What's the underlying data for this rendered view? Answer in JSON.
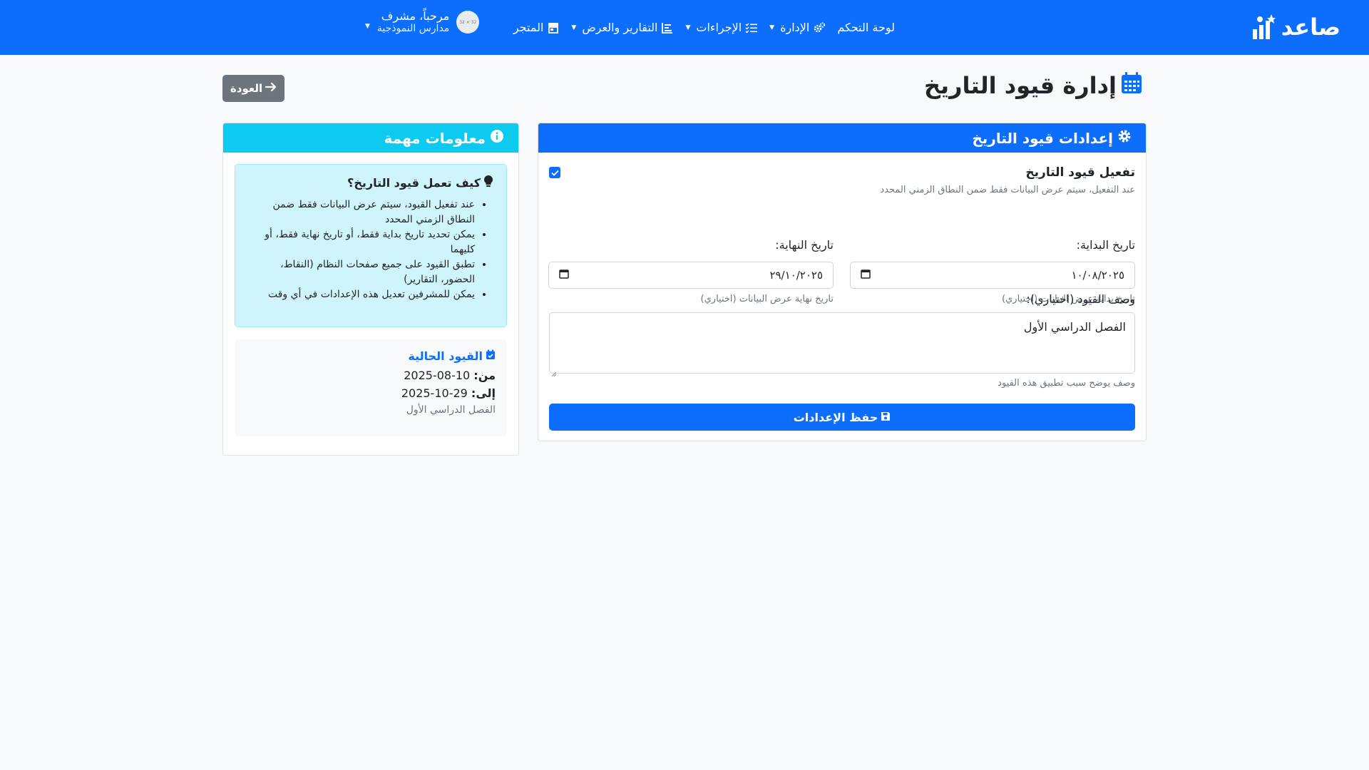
{
  "navbar": {
    "brand": "صاعد",
    "items": [
      {
        "label": "لوحة التحكم",
        "icon": "",
        "caret": false
      },
      {
        "label": "الإدارة",
        "icon": "gears-icon",
        "caret": true
      },
      {
        "label": "الإجراءات",
        "icon": "list-check-icon",
        "caret": true
      },
      {
        "label": "التقارير والعرض",
        "icon": "chart-icon",
        "caret": true
      },
      {
        "label": "المتجر",
        "icon": "store-icon",
        "caret": false
      }
    ],
    "user": {
      "greeting": "مرحباً، مشرف",
      "school": "مدارس النموذجية",
      "avatar_text": "32 × 32"
    }
  },
  "page": {
    "title": "إدارة قيود التاريخ",
    "back_label": "العودة"
  },
  "settings": {
    "header": "إعدادات قيود التاريخ",
    "enable_label": "تفعيل قيود التاريخ",
    "enable_checked": true,
    "enable_help": "عند التفعيل، سيتم عرض البيانات فقط ضمن النطاق الزمني المحدد",
    "start_label": "تاريخ البداية:",
    "start_value": "١٠/٠٨/٢٠٢٥",
    "start_help": "تاريخ بداية عرض البيانات (اختياري)",
    "end_label": "تاريخ النهاية:",
    "end_value": "٢٩/١٠/٢٠٢٥",
    "end_help": "تاريخ نهاية عرض البيانات (اختياري)",
    "desc_label": "وصف القيود (اختياري):",
    "desc_value": "الفصل الدراسي الأول",
    "desc_help": "وصف يوضح سبب تطبيق هذه القيود",
    "save_label": "حفظ الإعدادات"
  },
  "info": {
    "header": "معلومات مهمة",
    "how_title": "كيف تعمل قيود التاريخ؟",
    "bullets": [
      "عند تفعيل القيود، سيتم عرض البيانات فقط ضمن النطاق الزمني المحدد",
      "يمكن تحديد تاريخ بداية فقط، أو تاريخ نهاية فقط، أو كليهما",
      "تطبق القيود على جميع صفحات النظام (النقاط، الحضور، التقارير)",
      "يمكن للمشرفين تعديل هذه الإعدادات في أي وقت"
    ],
    "current_title": "القيود الحالية",
    "from_label": "من:",
    "from_value": "10-08-2025",
    "to_label": "إلى:",
    "to_value": "29-10-2025",
    "current_note": "الفصل الدراسي الأول"
  },
  "colors": {
    "primary": "#0d6efd",
    "info": "#0dcaf0",
    "secondary": "#6c757d",
    "alert_bg": "#cff4fc"
  }
}
